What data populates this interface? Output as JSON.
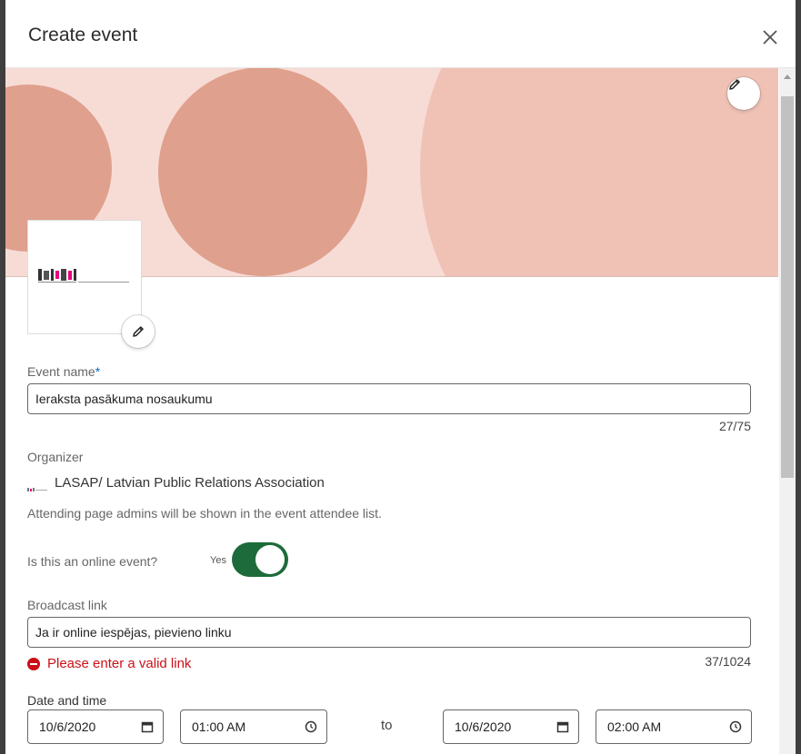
{
  "header": {
    "title": "Create event"
  },
  "form": {
    "event_name": {
      "label": "Event name",
      "required_mark": "*",
      "value": "Ieraksta pasākuma nosaukumu",
      "counter": "27/75"
    },
    "organizer": {
      "label": "Organizer",
      "name": "LASAP/ Latvian Public Relations Association",
      "hint": "Attending page admins will be shown in the event attendee list."
    },
    "online": {
      "label": "Is this an online event?",
      "toggle_text": "Yes",
      "enabled": true
    },
    "broadcast": {
      "label": "Broadcast link",
      "value": "Ja ir online iespējas, pievieno linku",
      "error": "Please enter a valid link",
      "counter": "37/1024"
    },
    "datetime": {
      "label": "Date and time",
      "start_date": "10/6/2020",
      "start_time": "01:00 AM",
      "to_label": "to",
      "end_date": "10/6/2020",
      "end_time": "02:00 AM"
    }
  },
  "icons": {
    "close": "close-icon",
    "edit": "pencil-icon",
    "calendar": "calendar-icon",
    "clock": "clock-icon",
    "error": "error-icon"
  },
  "colors": {
    "banner_bg": "#f7dcd6",
    "circle_dark": "#e0a08e",
    "circle_light": "#f0c2b6",
    "toggle_on": "#1d6b3a",
    "error": "#cc1016",
    "required": "#0a66c2"
  }
}
